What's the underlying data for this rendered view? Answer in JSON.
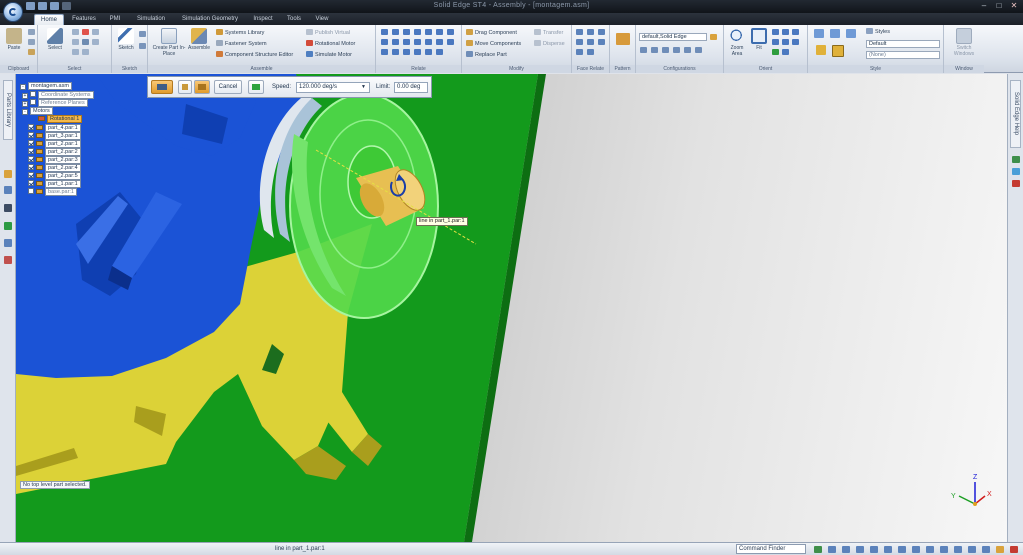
{
  "app": {
    "window_title": "Solid Edge ST4 - Assembly - [montagem.asm]"
  },
  "tabs": [
    {
      "label": "Home",
      "active": true
    },
    {
      "label": "Features"
    },
    {
      "label": "PMI"
    },
    {
      "label": "Simulation"
    },
    {
      "label": "Simulation Geometry"
    },
    {
      "label": "Inspect"
    },
    {
      "label": "Tools"
    },
    {
      "label": "View"
    }
  ],
  "ribbon": {
    "groups": {
      "clipboard": "Clipboard",
      "select": "Select",
      "sketch": "Sketch",
      "assemble": "Assemble",
      "relate": "Relate",
      "modify": "Modify",
      "face_relate": "Face Relate",
      "pattern": "Pattern",
      "configurations": "Configurations",
      "orient": "Orient",
      "style": "Style",
      "window": "Window"
    },
    "paste": "Paste",
    "select": "Select",
    "sketch": "Sketch",
    "create_part": "Create Part In-Place",
    "assemble": "Assemble",
    "systems_library": "Systems Library",
    "fastener_system": "Fastener System",
    "structure_editor": "Component Structure Editor",
    "publish_virtual": "Publish Virtual",
    "rotational_motor": "Rotational Motor",
    "simulate_motor": "Simulate Motor",
    "drag_component": "Drag Component",
    "move_components": "Move Components",
    "replace_part": "Replace Part",
    "transfer": "Transfer",
    "disperse": "Disperse",
    "config_value": "default,Solid Edge",
    "zoom_area": "Zoom Area",
    "fit": "Fit",
    "styles": "Styles",
    "style_default": "Default",
    "style_none": "(None)",
    "switch_windows": "Switch Windows"
  },
  "left_panel": {
    "label": "Parts Library"
  },
  "right_panel": {
    "label": "Solid Edge Help"
  },
  "command_bar": {
    "cancel": "Cancel",
    "speed_label": "Speed:",
    "speed_value": "120.000 deg/s",
    "limit_label": "Limit:",
    "limit_value": "0.00 deg"
  },
  "tree": {
    "root": "montagem.asm",
    "items": [
      {
        "label": "Coordinate Systems",
        "dim": true
      },
      {
        "label": "Reference Planes",
        "dim": true
      },
      {
        "label": "Motors"
      },
      {
        "label": "Rotational 1",
        "highlight": true
      },
      {
        "label": "part_4.par:1"
      },
      {
        "label": "part_3.par:1"
      },
      {
        "label": "part_2.par:1"
      },
      {
        "label": "part_2.par:2"
      },
      {
        "label": "part_2.par:3"
      },
      {
        "label": "part_2.par:4"
      },
      {
        "label": "part_2.par:5"
      },
      {
        "label": "part_1.par:1"
      },
      {
        "label": "base.par:1",
        "dim": true
      }
    ]
  },
  "tooltip": "line in part_1.par:1",
  "hint": "No top level part selected.",
  "status": {
    "text": "line in part_1.par:1",
    "command_finder": "Command Finder"
  },
  "triad": {
    "x": "X",
    "y": "Y",
    "z": "Z"
  },
  "colors": {
    "green_plate": "#139a1c",
    "blue_part": "#1b53d6",
    "yellow_part": "#dcd237",
    "motor_wheel": "#52d94b"
  }
}
